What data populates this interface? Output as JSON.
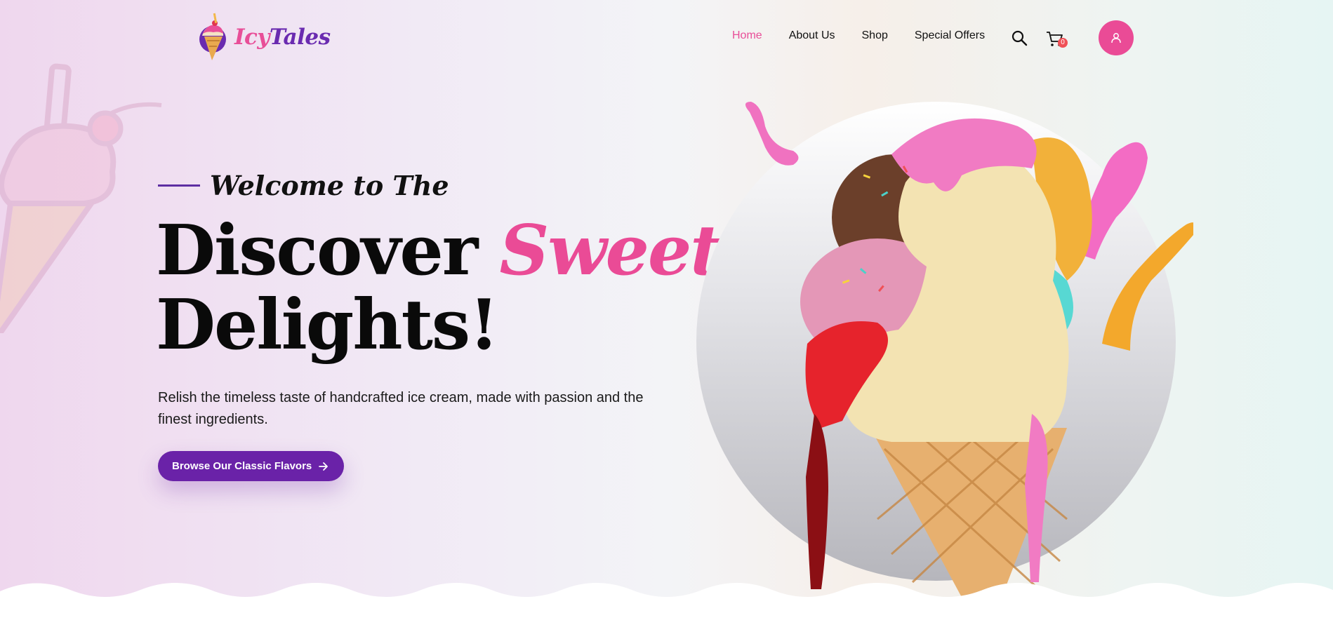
{
  "brand": {
    "name_part1": "Icy",
    "name_part2": "Tales",
    "logo_icon": "ice-cream-cone-logo-icon",
    "colors": {
      "pink": "#ea4b96",
      "purple": "#6a22a8"
    }
  },
  "nav": {
    "items": [
      {
        "label": "Home",
        "active": true
      },
      {
        "label": "About Us",
        "active": false
      },
      {
        "label": "Shop",
        "active": false
      },
      {
        "label": "Special Offers",
        "active": false
      }
    ],
    "search_icon": "search-icon",
    "cart_icon": "cart-icon",
    "cart_count": "0",
    "user_icon": "user-icon"
  },
  "hero": {
    "eyebrow": "Welcome to The",
    "headline_part1": "Discover ",
    "headline_highlight": "Sweet",
    "headline_part2": "Delights!",
    "description": "Relish the timeless taste of handcrafted ice cream, made with passion and the finest ingredients.",
    "cta_label": "Browse Our Classic Flavors",
    "cta_icon": "arrow-right-icon",
    "image": "melting-ice-cream-cone-illustration"
  }
}
